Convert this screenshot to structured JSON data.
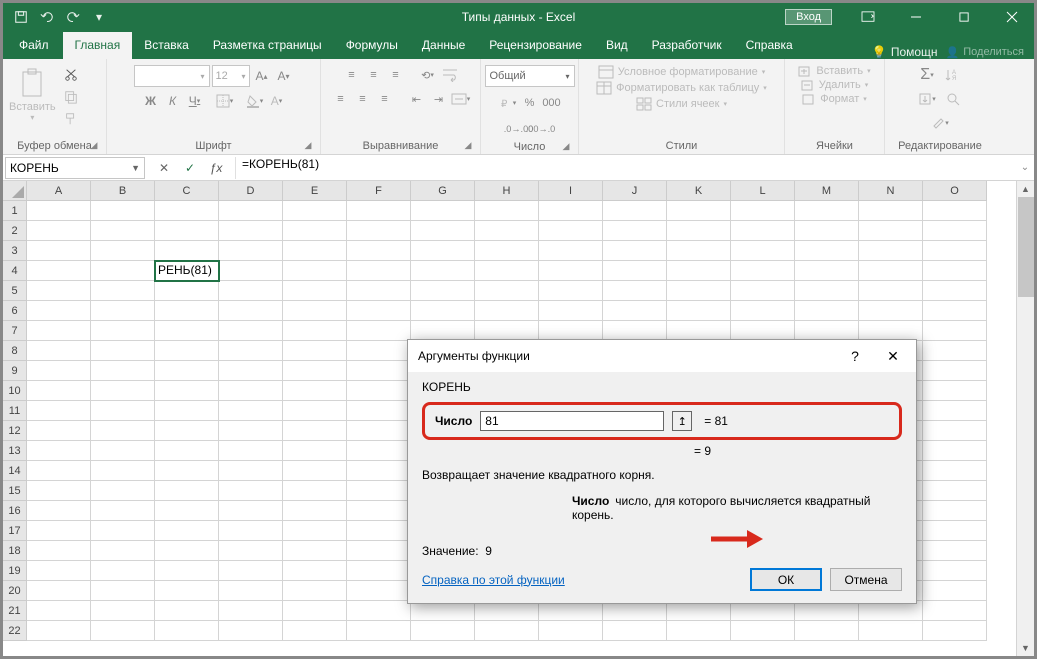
{
  "title": "Типы данных  -  Excel",
  "login_btn": "Вход",
  "tabs": {
    "file": "Файл",
    "home": "Главная",
    "insert": "Вставка",
    "pagelayout": "Разметка страницы",
    "formulas": "Формулы",
    "data": "Данные",
    "review": "Рецензирование",
    "view": "Вид",
    "developer": "Разработчик",
    "help": "Справка",
    "tellme": "Помощн",
    "share": "Поделиться"
  },
  "ribbon": {
    "clipboard": {
      "label": "Буфер обмена",
      "paste": "Вставить"
    },
    "font": {
      "label": "Шрифт",
      "size": "12",
      "bold": "Ж",
      "italic": "К",
      "underline": "Ч"
    },
    "align": {
      "label": "Выравнивание"
    },
    "number": {
      "label": "Число",
      "general": "Общий"
    },
    "styles": {
      "label": "Стили",
      "cond": "Условное форматирование",
      "table": "Форматировать как таблицу",
      "cell": "Стили ячеек"
    },
    "cells": {
      "label": "Ячейки",
      "insert": "Вставить",
      "delete": "Удалить",
      "format": "Формат"
    },
    "editing": {
      "label": "Редактирование"
    }
  },
  "namebox": "КОРЕНЬ",
  "formula": "=КОРЕНЬ(81)",
  "columns": [
    "A",
    "B",
    "C",
    "D",
    "E",
    "F",
    "G",
    "H",
    "I",
    "J",
    "K",
    "L",
    "M",
    "N",
    "O"
  ],
  "active_cell_display": "РЕНЬ(81)",
  "dialog": {
    "title": "Аргументы функции",
    "func": "КОРЕНЬ",
    "arg_label": "Число",
    "arg_value": "81",
    "arg_result": "=  81",
    "overall_result": "=   9",
    "desc": "Возвращает значение квадратного корня.",
    "arg_desc_label": "Число",
    "arg_desc_text": "число, для которого вычисляется квадратный корень.",
    "result_label": "Значение:",
    "result_value": "9",
    "help_link": "Справка по этой функции",
    "ok": "ОК",
    "cancel": "Отмена"
  }
}
